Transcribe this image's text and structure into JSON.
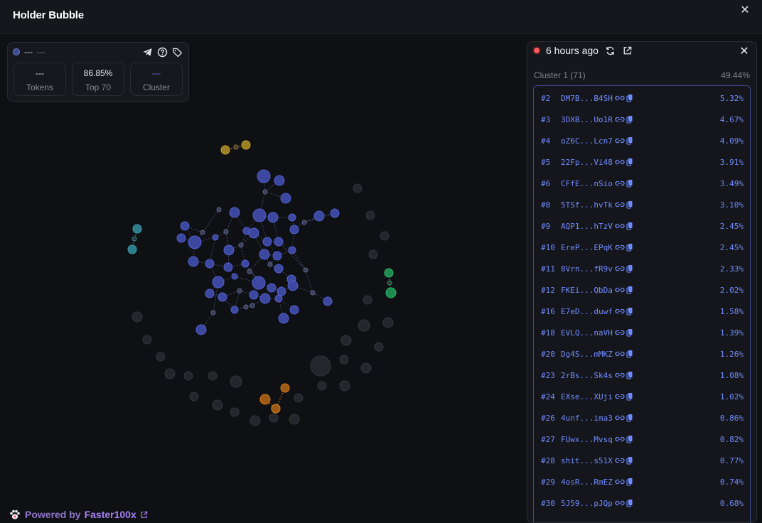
{
  "window": {
    "title": "Holder Bubble",
    "close_icon": "close-icon"
  },
  "info": {
    "name": "---",
    "sub": "---",
    "icons": [
      "telegram-icon",
      "help-icon",
      "tag-icon"
    ],
    "stats": [
      {
        "value": "---",
        "label": "Tokens"
      },
      {
        "value": "86.85%",
        "label": "Top 70"
      },
      {
        "value": "---",
        "label": "Cluster"
      }
    ]
  },
  "panel": {
    "time": "6 hours ago",
    "cluster_label": "Cluster 1 (71)",
    "cluster_pct": "49.44%",
    "rows": [
      {
        "rank": "#2",
        "addr": "DM7B...B4SH",
        "pct": "5.32%"
      },
      {
        "rank": "#3",
        "addr": "3DXB...Uo1R",
        "pct": "4.67%"
      },
      {
        "rank": "#4",
        "addr": "oZ6C...Lcn7",
        "pct": "4.09%"
      },
      {
        "rank": "#5",
        "addr": "22Fp...Vi48",
        "pct": "3.91%"
      },
      {
        "rank": "#6",
        "addr": "CFfE...nSio",
        "pct": "3.49%"
      },
      {
        "rank": "#8",
        "addr": "5TSf...hvTk",
        "pct": "3.10%"
      },
      {
        "rank": "#9",
        "addr": "AQP1...hTzV",
        "pct": "2.45%"
      },
      {
        "rank": "#10",
        "addr": "EreP...EPqK",
        "pct": "2.45%"
      },
      {
        "rank": "#11",
        "addr": "8Vrn...fR9v",
        "pct": "2.33%"
      },
      {
        "rank": "#12",
        "addr": "FKEi...QbDa",
        "pct": "2.02%"
      },
      {
        "rank": "#16",
        "addr": "E7eD...duwf",
        "pct": "1.58%"
      },
      {
        "rank": "#18",
        "addr": "EVLQ...naVH",
        "pct": "1.39%"
      },
      {
        "rank": "#20",
        "addr": "Dg4S...mMKZ",
        "pct": "1.26%"
      },
      {
        "rank": "#23",
        "addr": "2rBs...Sk4s",
        "pct": "1.08%"
      },
      {
        "rank": "#24",
        "addr": "EXse...XUji",
        "pct": "1.02%"
      },
      {
        "rank": "#26",
        "addr": "4unf...ima3",
        "pct": "0.86%"
      },
      {
        "rank": "#27",
        "addr": "FUwx...Mvsq",
        "pct": "0.82%"
      },
      {
        "rank": "#28",
        "addr": "shit...s51X",
        "pct": "0.77%"
      },
      {
        "rank": "#29",
        "addr": "4osR...RmEZ",
        "pct": "0.74%"
      },
      {
        "rank": "#30",
        "addr": "5J59...pJQp",
        "pct": "0.68%"
      }
    ]
  },
  "footer": {
    "prefix": "Powered by",
    "brand": "Faster100x"
  },
  "colors": {
    "cluster_blue": "#4b5bd6",
    "gold": "#c7a234",
    "teal": "#3aa1b3",
    "green": "#2eb86a",
    "orange": "#d57b1e",
    "gray": "#2a2b31"
  }
}
